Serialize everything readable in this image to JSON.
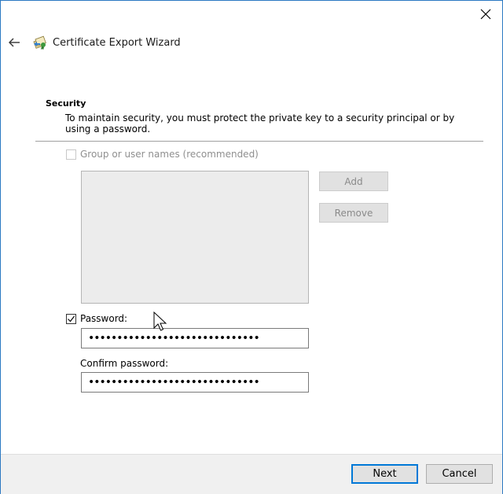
{
  "window": {
    "title": "Certificate Export Wizard"
  },
  "security": {
    "heading": "Security",
    "description": "To maintain security, you must protect the private key to a security principal or by using a password.",
    "group_checkbox_label": "Group or user names (recommended)",
    "group_checked": false,
    "add_label": "Add",
    "remove_label": "Remove",
    "password_checkbox_label": "Password:",
    "password_checked": true,
    "password_value": "••••••••••••••••••••••••••••••",
    "confirm_label": "Confirm password:",
    "confirm_value": "••••••••••••••••••••••••••••••"
  },
  "footer": {
    "next_label": "Next",
    "cancel_label": "Cancel"
  },
  "colors": {
    "window_border": "#2b79c2",
    "default_button_border": "#0078d7",
    "footer_bg": "#f0f0f0"
  },
  "icons": {
    "close": "close-icon",
    "back": "back-arrow-icon",
    "wizard": "certificate-icon",
    "cursor": "mouse-pointer-icon"
  }
}
